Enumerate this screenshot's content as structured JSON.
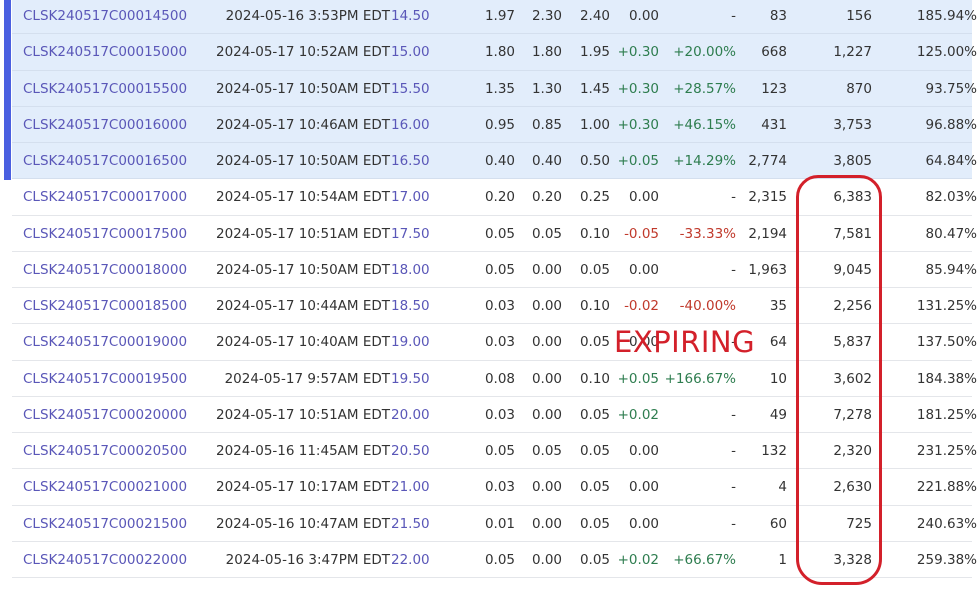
{
  "colors": {
    "accent": "#4a5fe0",
    "in_the_money_bg": "#e2edfb",
    "positive": "#2e7d4f",
    "negative": "#c0392b",
    "annotation": "#d3202a"
  },
  "annotation": {
    "label": "EXPIRING"
  },
  "rows": [
    {
      "symbol": "CLSK240517C00014500",
      "date": "2024-05-16 3:53PM EDT",
      "strike": "14.50",
      "last": "1.97",
      "bid": "2.30",
      "ask": "2.40",
      "change": "0.00",
      "pct": "-",
      "volume": "83",
      "oi": "156",
      "iv": "185.94%",
      "itm": true
    },
    {
      "symbol": "CLSK240517C00015000",
      "date": "2024-05-17 10:52AM EDT",
      "strike": "15.00",
      "last": "1.80",
      "bid": "1.80",
      "ask": "1.95",
      "change": "+0.30",
      "pct": "+20.00%",
      "volume": "668",
      "oi": "1,227",
      "iv": "125.00%",
      "itm": true
    },
    {
      "symbol": "CLSK240517C00015500",
      "date": "2024-05-17 10:50AM EDT",
      "strike": "15.50",
      "last": "1.35",
      "bid": "1.30",
      "ask": "1.45",
      "change": "+0.30",
      "pct": "+28.57%",
      "volume": "123",
      "oi": "870",
      "iv": "93.75%",
      "itm": true
    },
    {
      "symbol": "CLSK240517C00016000",
      "date": "2024-05-17 10:46AM EDT",
      "strike": "16.00",
      "last": "0.95",
      "bid": "0.85",
      "ask": "1.00",
      "change": "+0.30",
      "pct": "+46.15%",
      "volume": "431",
      "oi": "3,753",
      "iv": "96.88%",
      "itm": true
    },
    {
      "symbol": "CLSK240517C00016500",
      "date": "2024-05-17 10:50AM EDT",
      "strike": "16.50",
      "last": "0.40",
      "bid": "0.40",
      "ask": "0.50",
      "change": "+0.05",
      "pct": "+14.29%",
      "volume": "2,774",
      "oi": "3,805",
      "iv": "64.84%",
      "itm": true
    },
    {
      "symbol": "CLSK240517C00017000",
      "date": "2024-05-17 10:54AM EDT",
      "strike": "17.00",
      "last": "0.20",
      "bid": "0.20",
      "ask": "0.25",
      "change": "0.00",
      "pct": "-",
      "volume": "2,315",
      "oi": "6,383",
      "iv": "82.03%",
      "itm": false
    },
    {
      "symbol": "CLSK240517C00017500",
      "date": "2024-05-17 10:51AM EDT",
      "strike": "17.50",
      "last": "0.05",
      "bid": "0.05",
      "ask": "0.10",
      "change": "-0.05",
      "pct": "-33.33%",
      "volume": "2,194",
      "oi": "7,581",
      "iv": "80.47%",
      "itm": false
    },
    {
      "symbol": "CLSK240517C00018000",
      "date": "2024-05-17 10:50AM EDT",
      "strike": "18.00",
      "last": "0.05",
      "bid": "0.00",
      "ask": "0.05",
      "change": "0.00",
      "pct": "-",
      "volume": "1,963",
      "oi": "9,045",
      "iv": "85.94%",
      "itm": false
    },
    {
      "symbol": "CLSK240517C00018500",
      "date": "2024-05-17 10:44AM EDT",
      "strike": "18.50",
      "last": "0.03",
      "bid": "0.00",
      "ask": "0.10",
      "change": "-0.02",
      "pct": "-40.00%",
      "volume": "35",
      "oi": "2,256",
      "iv": "131.25%",
      "itm": false
    },
    {
      "symbol": "CLSK240517C00019000",
      "date": "2024-05-17 10:40AM EDT",
      "strike": "19.00",
      "last": "0.03",
      "bid": "0.00",
      "ask": "0.05",
      "change": "0.00",
      "pct": "-",
      "volume": "64",
      "oi": "5,837",
      "iv": "137.50%",
      "itm": false
    },
    {
      "symbol": "CLSK240517C00019500",
      "date": "2024-05-17 9:57AM EDT",
      "strike": "19.50",
      "last": "0.08",
      "bid": "0.00",
      "ask": "0.10",
      "change": "+0.05",
      "pct": "+166.67%",
      "volume": "10",
      "oi": "3,602",
      "iv": "184.38%",
      "itm": false
    },
    {
      "symbol": "CLSK240517C00020000",
      "date": "2024-05-17 10:51AM EDT",
      "strike": "20.00",
      "last": "0.03",
      "bid": "0.00",
      "ask": "0.05",
      "change": "+0.02",
      "pct": "-",
      "volume": "49",
      "oi": "7,278",
      "iv": "181.25%",
      "itm": false
    },
    {
      "symbol": "CLSK240517C00020500",
      "date": "2024-05-16 11:45AM EDT",
      "strike": "20.50",
      "last": "0.05",
      "bid": "0.05",
      "ask": "0.05",
      "change": "0.00",
      "pct": "-",
      "volume": "132",
      "oi": "2,320",
      "iv": "231.25%",
      "itm": false
    },
    {
      "symbol": "CLSK240517C00021000",
      "date": "2024-05-17 10:17AM EDT",
      "strike": "21.00",
      "last": "0.03",
      "bid": "0.00",
      "ask": "0.05",
      "change": "0.00",
      "pct": "-",
      "volume": "4",
      "oi": "2,630",
      "iv": "221.88%",
      "itm": false
    },
    {
      "symbol": "CLSK240517C00021500",
      "date": "2024-05-16 10:47AM EDT",
      "strike": "21.50",
      "last": "0.01",
      "bid": "0.00",
      "ask": "0.05",
      "change": "0.00",
      "pct": "-",
      "volume": "60",
      "oi": "725",
      "iv": "240.63%",
      "itm": false
    },
    {
      "symbol": "CLSK240517C00022000",
      "date": "2024-05-16 3:47PM EDT",
      "strike": "22.00",
      "last": "0.05",
      "bid": "0.00",
      "ask": "0.05",
      "change": "+0.02",
      "pct": "+66.67%",
      "volume": "1",
      "oi": "3,328",
      "iv": "259.38%",
      "itm": false
    }
  ]
}
